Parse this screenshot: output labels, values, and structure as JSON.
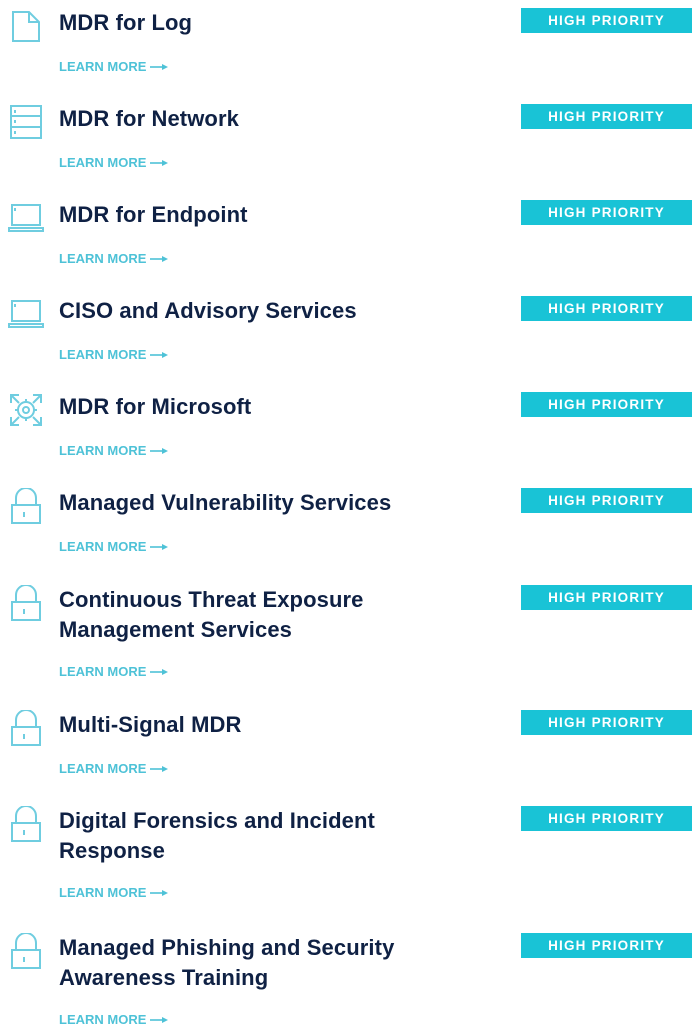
{
  "colors": {
    "title": "#0f2144",
    "badge_bg": "#19c3d6",
    "badge_text": "#ffffff",
    "link": "#4ec2d7",
    "icon_stroke": "#6fcde0"
  },
  "services": [
    {
      "title": "MDR for Log",
      "badge": "HIGH PRIORITY",
      "link": "LEARN MORE",
      "icon": "document-icon"
    },
    {
      "title": "MDR for Network",
      "badge": "HIGH PRIORITY",
      "link": "LEARN MORE",
      "icon": "server-stack-icon"
    },
    {
      "title": "MDR for Endpoint",
      "badge": "HIGH PRIORITY",
      "link": "LEARN MORE",
      "icon": "laptop-icon"
    },
    {
      "title": "CISO and Advisory Services",
      "badge": "HIGH PRIORITY",
      "link": "LEARN MORE",
      "icon": "laptop-icon"
    },
    {
      "title": "MDR for Microsoft",
      "badge": "HIGH PRIORITY",
      "link": "LEARN MORE",
      "icon": "gear-target-icon"
    },
    {
      "title": "Managed Vulnerability Services",
      "badge": "HIGH PRIORITY",
      "link": "LEARN MORE",
      "icon": "padlock-icon"
    },
    {
      "title": "Continuous Threat Exposure Management Services",
      "badge": "HIGH PRIORITY",
      "link": "LEARN MORE",
      "icon": "padlock-icon"
    },
    {
      "title": "Multi-Signal MDR",
      "badge": "HIGH PRIORITY",
      "link": "LEARN MORE",
      "icon": "padlock-icon"
    },
    {
      "title": "Digital Forensics and Incident Response",
      "badge": "HIGH PRIORITY",
      "link": "LEARN MORE",
      "icon": "padlock-icon"
    },
    {
      "title": "Managed Phishing and Security Awareness Training",
      "badge": "HIGH PRIORITY",
      "link": "LEARN MORE",
      "icon": "padlock-icon"
    }
  ]
}
